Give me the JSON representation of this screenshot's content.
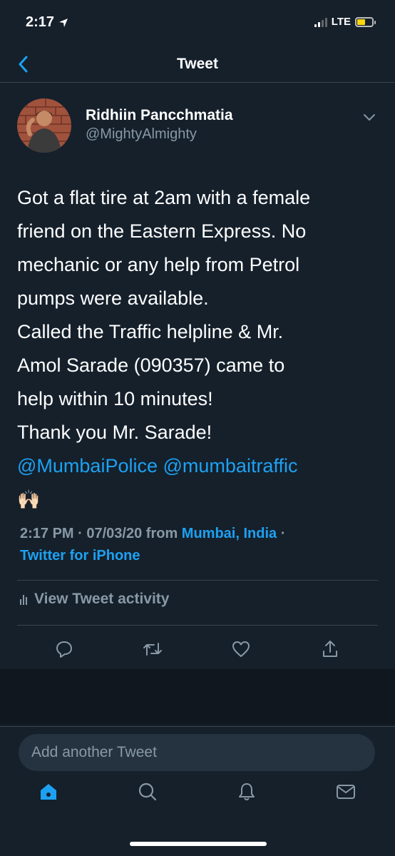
{
  "status_bar": {
    "time": "2:17",
    "network": "LTE",
    "battery_color": "#ffd60a"
  },
  "nav": {
    "title": "Tweet",
    "back_icon": "chevron-left-icon"
  },
  "tweet": {
    "author_name": "Ridhiin Pancchmatia",
    "author_handle": "@MightyAlmighty",
    "body_lines": [
      "Got a flat tire at 2am with a female",
      "friend on the Eastern Express. No",
      "mechanic or any help from Petrol",
      "pumps were available.",
      "Called the Traffic helpline & Mr.",
      "Amol Sarade (090357) came to",
      "help within 10 minutes!",
      "Thank you Mr. Sarade!"
    ],
    "mentions": [
      "@MumbaiPolice",
      "@mumbaitraffic"
    ],
    "emoji": "🙌🏻",
    "timestamp": "2:17 PM · 07/03/20",
    "from_label": "from",
    "location": "Mumbai, India",
    "separator": "·",
    "client": "Twitter for iPhone",
    "activity_label": "View Tweet activity"
  },
  "actions": {
    "icons": [
      "reply-icon",
      "retweet-icon",
      "like-icon",
      "share-icon"
    ]
  },
  "compose": {
    "placeholder": "Add another Tweet"
  },
  "tabbar": {
    "icons": [
      "home-icon",
      "search-icon",
      "notifications-icon",
      "messages-icon"
    ],
    "active": "home-icon"
  },
  "colors": {
    "background": "#15202b",
    "accent": "#1da1f2",
    "muted": "#8899a6",
    "divider": "#38444d"
  }
}
